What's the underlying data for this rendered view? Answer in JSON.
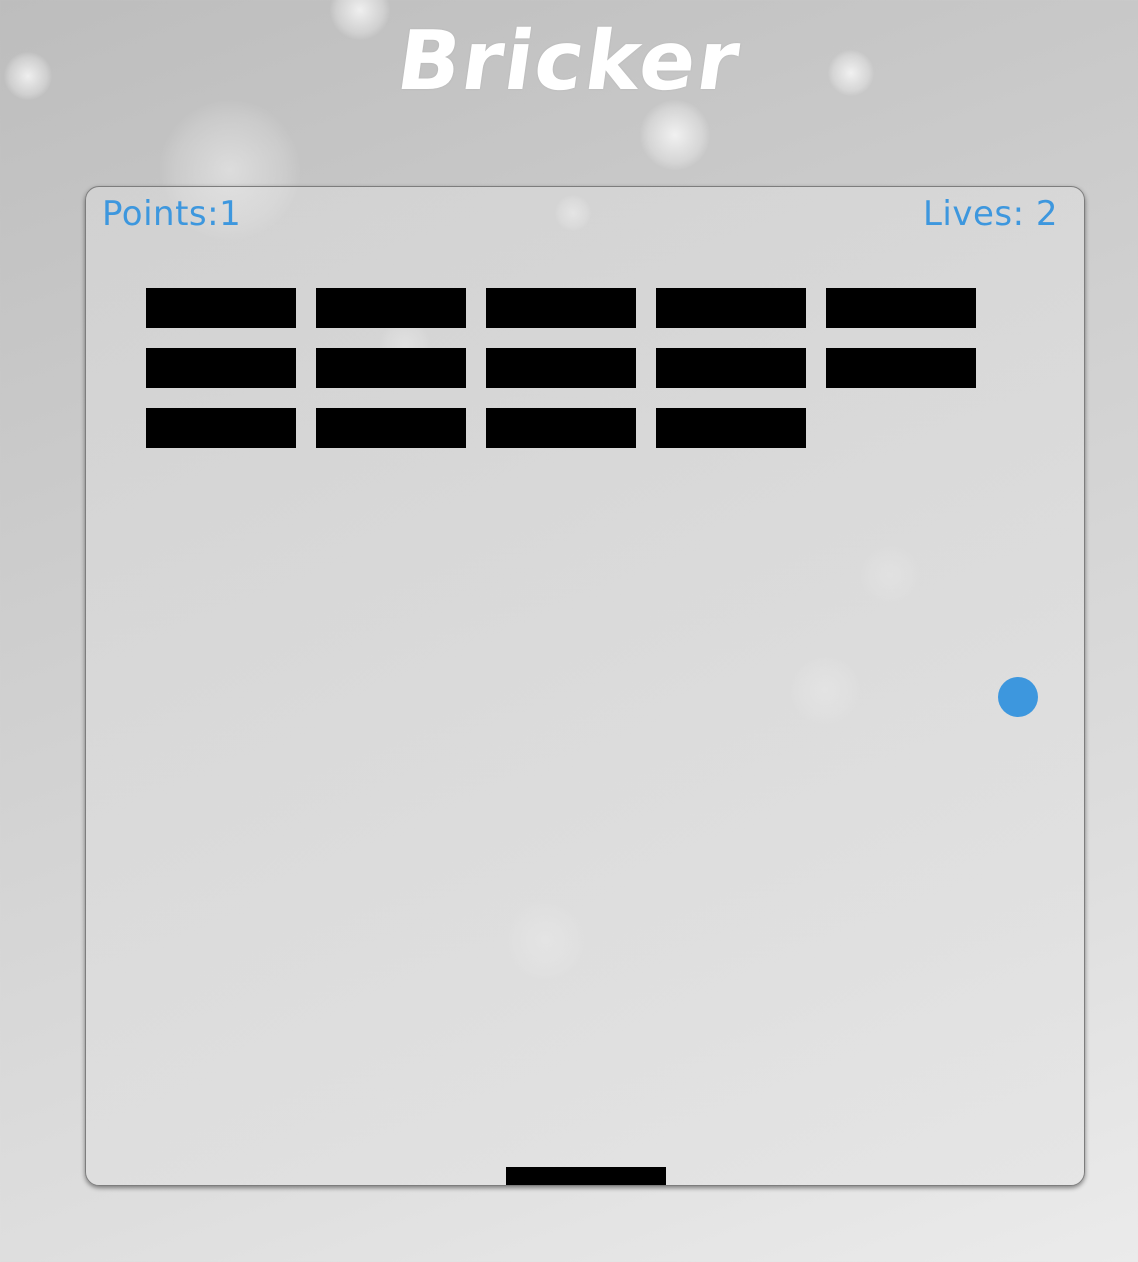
{
  "game": {
    "title": "Bricker",
    "hud": {
      "points_label": "Points:",
      "points_value": "1",
      "lives_label": "Lives:",
      "lives_value": "2"
    },
    "bricks": {
      "rows": [
        [
          true,
          true,
          true,
          true,
          true
        ],
        [
          true,
          true,
          true,
          true,
          true
        ],
        [
          true,
          true,
          true,
          true,
          false
        ]
      ],
      "color": "#000000"
    },
    "ball_color": "#3d97de",
    "paddle_color": "#000000",
    "text_accent_color": "#3d97de"
  }
}
